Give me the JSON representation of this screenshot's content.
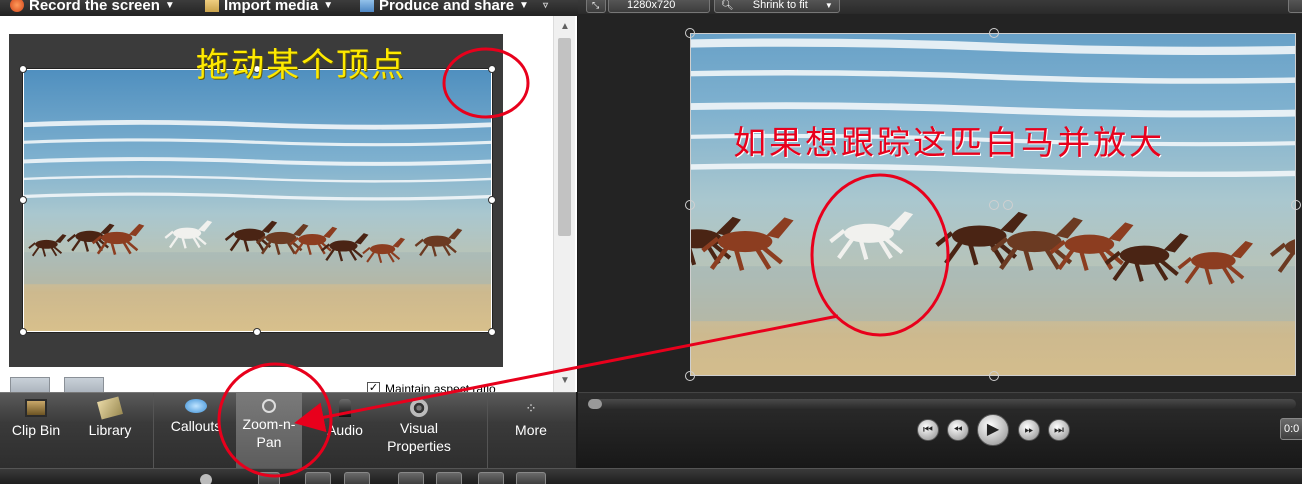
{
  "menu": {
    "record": "Record the screen",
    "import": "Import media",
    "produce": "Produce and share"
  },
  "canvas_toolbar": {
    "resolution": "1280x720",
    "zoom_option": "Shrink to fit"
  },
  "annotations": {
    "drag_corner": "拖动某个顶点",
    "track_horse": "如果想跟踪这匹白马并放大"
  },
  "properties": {
    "maintain_aspect_ratio": "Maintain aspect ratio",
    "maintain_checked": true
  },
  "tabs": [
    {
      "label": "Clip Bin",
      "icon": "film-strip-icon"
    },
    {
      "label": "Library",
      "icon": "library-icon"
    },
    {
      "label": "Callouts",
      "icon": "speech-bubble-icon"
    },
    {
      "label": "Zoom-n-\nPan",
      "icon": "magnifier-icon",
      "selected": true
    },
    {
      "label": "Audio",
      "icon": "speaker-icon"
    },
    {
      "label": "Visual\nProperties",
      "icon": "film-reel-icon"
    },
    {
      "label": "More",
      "icon": "dots-icon"
    }
  ],
  "player": {
    "timecode": "0:0"
  },
  "colors": {
    "annotation_yellow": "#ffea00",
    "annotation_red": "#e8001c"
  }
}
